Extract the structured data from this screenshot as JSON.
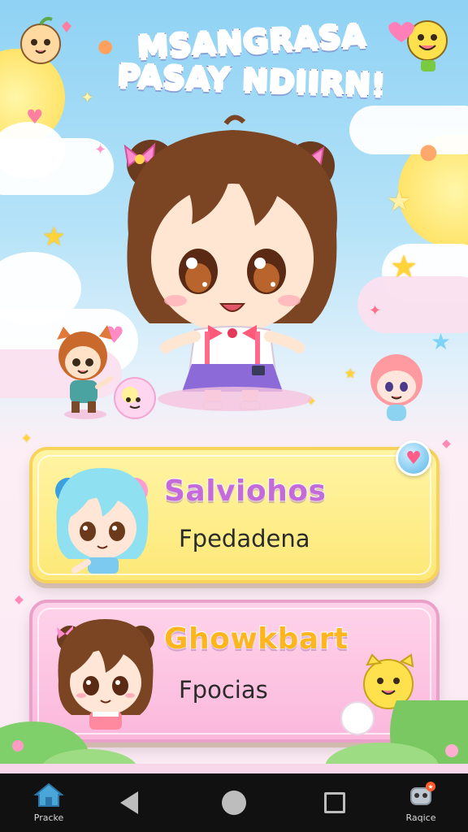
{
  "game": {
    "title_line1": "MSANGRASA",
    "title_line2": "PASAY NDIIRN!"
  },
  "cards": [
    {
      "title": "Salviohos",
      "subtitle": "Fpedadena",
      "accent": "#c46bd9",
      "background": "#fde877"
    },
    {
      "title": "Ghowkbart",
      "subtitle": "Fpocias",
      "accent": "#ffb61e",
      "background": "#fbb8dc"
    }
  ],
  "badge": {
    "icon": "heart-icon"
  },
  "navbar": {
    "home_label": "Pracke",
    "right_label": "Raqice",
    "back_icon": "back-triangle-icon",
    "home_icon": "home-circle-icon",
    "recent_icon": "recent-square-icon"
  },
  "colors": {
    "sky_top": "#8fd2f4",
    "pink_ground": "#fbe9f3",
    "navbar": "#111111"
  }
}
